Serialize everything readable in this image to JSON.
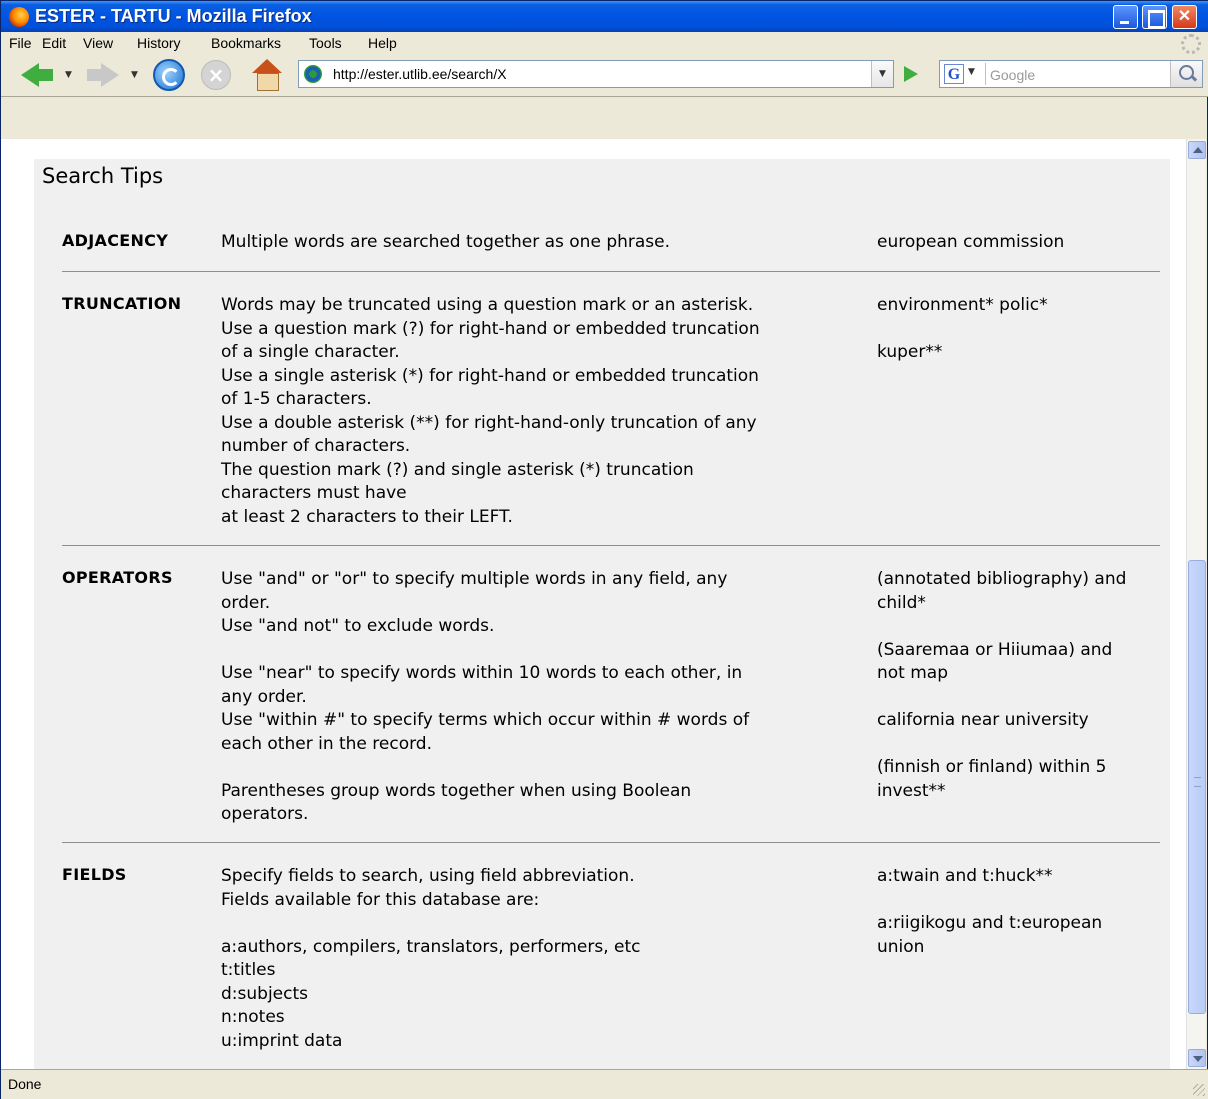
{
  "window": {
    "title": "ESTER - TARTU - Mozilla Firefox",
    "controls": {
      "minimize": "",
      "maximize": "",
      "close": "✕"
    }
  },
  "menu": [
    "File",
    "Edit",
    "View",
    "History",
    "Bookmarks",
    "Tools",
    "Help"
  ],
  "navigation": {
    "url": "http://ester.utlib.ee/search/X",
    "search_placeholder": "Google",
    "search_engine_icon": "G"
  },
  "page": {
    "heading": "Search Tips",
    "sections": [
      {
        "term": "ADJACENCY",
        "description": [
          "Multiple words are searched together as one phrase."
        ],
        "examples": [
          "european commission"
        ]
      },
      {
        "term": "TRUNCATION",
        "description": [
          "Words may be truncated using a question mark or an asterisk.",
          "Use a question mark (?) for right-hand or embedded truncation",
          "of a single character.",
          "Use a single asterisk (*) for right-hand or embedded truncation",
          "of 1-5 characters.",
          "Use a double asterisk (**) for right-hand-only truncation of any",
          "number of characters.",
          "The question mark (?) and single asterisk (*) truncation",
          "characters must have",
          "at least 2 characters to their LEFT."
        ],
        "examples": [
          "environment* polic*",
          "",
          "kuper**"
        ]
      },
      {
        "term": "OPERATORS",
        "description": [
          "Use \"and\" or \"or\" to specify multiple words in any field, any",
          "order.",
          "Use \"and not\" to exclude words.",
          "",
          "Use \"near\" to specify words within 10 words to each other, in",
          "any order.",
          "Use \"within #\" to specify terms which occur within # words of",
          "each other in the record.",
          "",
          "Parentheses group words together when using Boolean",
          "operators."
        ],
        "examples": [
          "(annotated bibliography) and",
          "child*",
          "",
          "(Saaremaa or Hiiumaa) and",
          "not map",
          "",
          "california near university",
          "",
          "(finnish or finland) within 5",
          "invest**"
        ]
      },
      {
        "term": "FIELDS",
        "description": [
          "Specify fields to search, using field abbreviation.",
          "Fields available for this database are:",
          "",
          "a:authors, compilers, translators, performers, etc",
          "t:titles",
          "d:subjects",
          "n:notes",
          "u:imprint data"
        ],
        "examples": [
          "a:twain and t:huck**",
          "",
          "a:riigikogu and t:european",
          "union"
        ]
      }
    ]
  },
  "status": "Done"
}
